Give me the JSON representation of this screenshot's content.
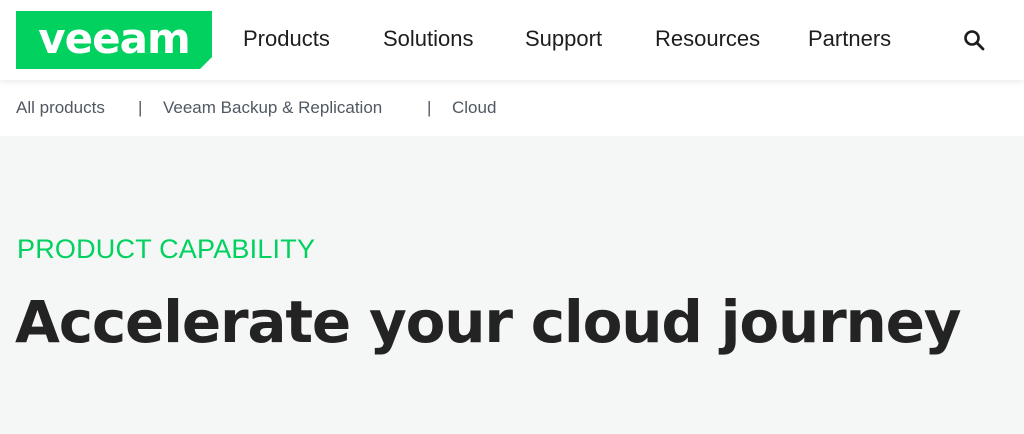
{
  "brand": {
    "logo_text": "veeam",
    "color": "#00d15f"
  },
  "nav": {
    "items": [
      {
        "label": "Products"
      },
      {
        "label": "Solutions"
      },
      {
        "label": "Support"
      },
      {
        "label": "Resources"
      },
      {
        "label": "Partners"
      }
    ],
    "search_icon": "search-icon"
  },
  "breadcrumb": {
    "items": [
      {
        "label": "All products"
      },
      {
        "label": "Veeam Backup & Replication"
      },
      {
        "label": "Cloud"
      }
    ],
    "separator": "|"
  },
  "hero": {
    "eyebrow": "PRODUCT CAPABILITY",
    "headline": "Accelerate your cloud journey"
  }
}
